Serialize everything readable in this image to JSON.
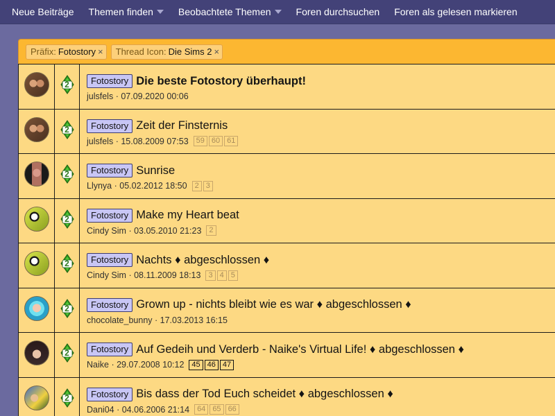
{
  "nav": {
    "items": [
      {
        "label": "Neue Beiträge",
        "dropdown": false
      },
      {
        "label": "Themen finden",
        "dropdown": true
      },
      {
        "label": "Beobachtete Themen",
        "dropdown": true
      },
      {
        "label": "Foren durchsuchen",
        "dropdown": false
      },
      {
        "label": "Foren als gelesen markieren",
        "dropdown": false
      }
    ]
  },
  "filters": [
    {
      "label": "Präfix:",
      "value": "Fotostory",
      "remove": "×"
    },
    {
      "label": "Thread Icon:",
      "value": "Die Sims 2",
      "remove": "×"
    }
  ],
  "threads": [
    {
      "prefix": "Fotostory",
      "title": "Die beste Fotostory überhaupt!",
      "bold": true,
      "author": "julsfels",
      "date": "07.09.2020 00:06",
      "pages": [],
      "icon_label": "2",
      "avatar": "avatar-julsfels"
    },
    {
      "prefix": "Fotostory",
      "title": "Zeit der Finsternis",
      "bold": false,
      "author": "julsfels",
      "date": "15.08.2009 07:53",
      "pages": [
        "59",
        "60",
        "61"
      ],
      "icon_label": "2",
      "avatar": "avatar-julsfels"
    },
    {
      "prefix": "Fotostory",
      "title": "Sunrise",
      "bold": false,
      "author": "Llynya",
      "date": "05.02.2012 18:50",
      "pages": [
        "2",
        "3"
      ],
      "icon_label": "2",
      "avatar": "avatar-llynya"
    },
    {
      "prefix": "Fotostory",
      "title": "Make my Heart beat",
      "bold": false,
      "author": "Cindy Sim",
      "date": "03.05.2010 21:23",
      "pages": [
        "2"
      ],
      "icon_label": "2",
      "avatar": "avatar-cindy"
    },
    {
      "prefix": "Fotostory",
      "title": "Nachts ♦ abgeschlossen ♦",
      "bold": false,
      "author": "Cindy Sim",
      "date": "08.11.2009 18:13",
      "pages": [
        "3",
        "4",
        "5"
      ],
      "icon_label": "2",
      "avatar": "avatar-cindy"
    },
    {
      "prefix": "Fotostory",
      "title": "Grown up - nichts bleibt wie es war ♦ abgeschlossen ♦",
      "bold": false,
      "author": "chocolate_bunny",
      "date": "17.03.2013 16:15",
      "pages": [],
      "icon_label": "2",
      "avatar": "avatar-chocolate"
    },
    {
      "prefix": "Fotostory",
      "title": "Auf Gedeih und Verderb - Naike's Virtual Life! ♦ abgeschlossen ♦",
      "bold": false,
      "author": "Naike",
      "date": "29.07.2008 10:12",
      "pages": [
        "45",
        "46",
        "47"
      ],
      "pages_strong": true,
      "icon_label": "2",
      "avatar": "avatar-naike"
    },
    {
      "prefix": "Fotostory",
      "title": "Bis dass der Tod Euch scheidet ♦ abgeschlossen ♦",
      "bold": false,
      "author": "Dani04",
      "date": "04.06.2006 21:14",
      "pages": [
        "64",
        "65",
        "66"
      ],
      "icon_label": "2",
      "avatar": "avatar-dani"
    }
  ],
  "colors": {
    "nav_bg": "#434278",
    "page_bg": "#6b6a9f",
    "filter_bar": "#fcb731",
    "list_bg": "#fdd983",
    "prefix_bg": "#c8c6f5"
  }
}
